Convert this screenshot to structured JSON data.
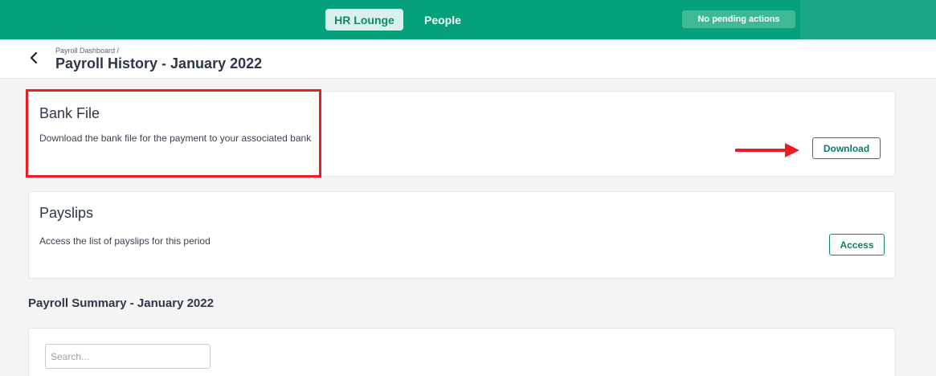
{
  "topbar": {
    "nav_items": [
      {
        "label": "HR Lounge"
      },
      {
        "label": "People"
      }
    ],
    "pending_label": "No pending actions"
  },
  "header": {
    "breadcrumb": "Payroll Dashboard /",
    "title": "Payroll History - January 2022"
  },
  "bank_file": {
    "title": "Bank File",
    "description": "Download the bank file for the payment to your associated bank",
    "button_label": "Download"
  },
  "payslips": {
    "title": "Payslips",
    "description": "Access the list of payslips for this period",
    "button_label": "Access"
  },
  "summary": {
    "title": "Payroll Summary - January 2022",
    "search_placeholder": "Search...",
    "search_value": ""
  },
  "colors": {
    "brand": "#06a07c",
    "highlight": "#ec1c24"
  },
  "icons": {
    "back": "chevron-left-icon",
    "annotation": "arrow-right-icon"
  }
}
